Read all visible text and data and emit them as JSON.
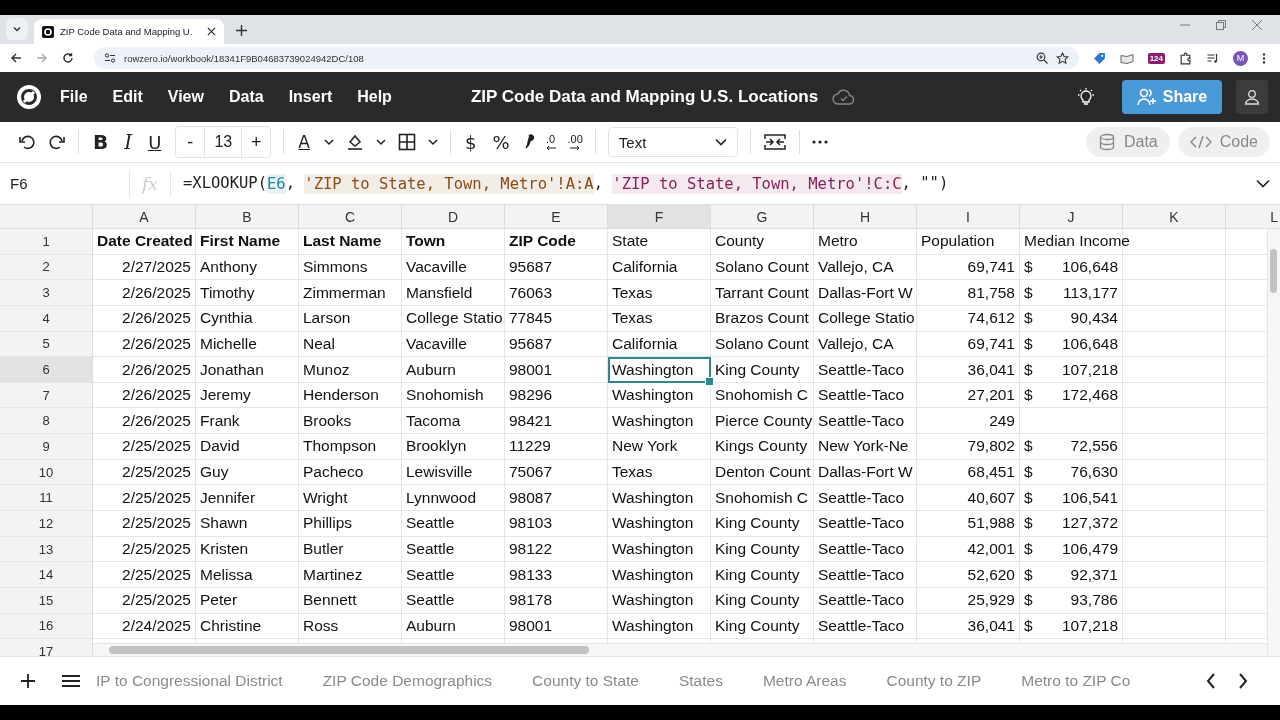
{
  "browser": {
    "tab_title": "ZIP Code Data and Mapping U.",
    "url": "rowzero.io/workbook/18341F9B04683739024942DC/108",
    "extension_badge": "124",
    "profile_initial": "M"
  },
  "app": {
    "menu": [
      "File",
      "Edit",
      "View",
      "Data",
      "Insert",
      "Help"
    ],
    "title": "ZIP Code Data and Mapping U.S. Locations",
    "share_label": "Share"
  },
  "toolbar": {
    "format_letters": [
      "B",
      "I",
      "U"
    ],
    "font_size": "13",
    "size_minus": "-",
    "size_plus": "+",
    "text_color_letter": "A",
    "currency": "$",
    "percent": "%",
    "decrease_decimals": ".0",
    "increase_decimals": ".00",
    "number_format": "Text",
    "data_label": "Data",
    "code_label": "Code"
  },
  "formula_bar": {
    "cell_name": "F6",
    "fx": "fx",
    "parts": [
      {
        "kind": "plain",
        "text": "=XLOOKUP("
      },
      {
        "kind": "ref",
        "text": "E6",
        "color": "#1f8a9c"
      },
      {
        "kind": "plain",
        "text": ", "
      },
      {
        "kind": "ref",
        "text": "'ZIP to State, Town, Metro'!A:A",
        "color": "#8a4b16"
      },
      {
        "kind": "plain",
        "text": ", "
      },
      {
        "kind": "ref",
        "text": "'ZIP to State, Town, Metro'!C:C",
        "color": "#8a1f5c"
      },
      {
        "kind": "plain",
        "text": ", \"\")"
      }
    ]
  },
  "table": {
    "columns": [
      {
        "label": "A",
        "kind": "right",
        "selected": false
      },
      {
        "label": "B",
        "kind": "left",
        "selected": false
      },
      {
        "label": "C",
        "kind": "left",
        "selected": false
      },
      {
        "label": "D",
        "kind": "left",
        "selected": false
      },
      {
        "label": "E",
        "kind": "left",
        "selected": false
      },
      {
        "label": "F",
        "kind": "left",
        "selected": true
      },
      {
        "label": "G",
        "kind": "left",
        "selected": false
      },
      {
        "label": "H",
        "kind": "left",
        "selected": false
      },
      {
        "label": "I",
        "kind": "right",
        "selected": false
      },
      {
        "label": "J",
        "kind": "currency",
        "selected": false
      },
      {
        "label": "K",
        "kind": "left",
        "selected": false
      },
      {
        "label": "L",
        "kind": "left",
        "selected": false
      }
    ],
    "rows": [
      {
        "num": "1",
        "kind": "header",
        "selected": false,
        "cells": [
          {
            "text": "Date Created",
            "bold": true
          },
          {
            "text": "First Name",
            "bold": true
          },
          {
            "text": "Last Name",
            "bold": true
          },
          {
            "text": "Town",
            "bold": true
          },
          {
            "text": "ZIP Code",
            "bold": true
          },
          {
            "text": "State",
            "bold": false
          },
          {
            "text": "County",
            "bold": false
          },
          {
            "text": "Metro",
            "bold": false
          },
          {
            "text": "Population",
            "bold": false
          },
          {
            "text": "Median Income",
            "bold": false
          }
        ]
      },
      {
        "num": "2",
        "kind": "data",
        "selected": false,
        "cells": [
          "2/27/2025",
          "Anthony",
          "Simmons",
          "Vacaville",
          "95687",
          "California",
          "Solano Count",
          "Vallejo, CA",
          "69,741",
          {
            "currency": "$",
            "amount": "106,648"
          }
        ]
      },
      {
        "num": "3",
        "kind": "data",
        "selected": false,
        "cells": [
          "2/26/2025",
          "Timothy",
          "Zimmerman",
          "Mansfield",
          "76063",
          "Texas",
          "Tarrant Count",
          "Dallas-Fort W",
          "81,758",
          {
            "currency": "$",
            "amount": "113,177"
          }
        ]
      },
      {
        "num": "4",
        "kind": "data",
        "selected": false,
        "cells": [
          "2/26/2025",
          "Cynthia",
          "Larson",
          "College Statio",
          "77845",
          "Texas",
          "Brazos Count",
          "College Statio",
          "74,612",
          {
            "currency": "$",
            "amount": "90,434"
          }
        ]
      },
      {
        "num": "5",
        "kind": "data",
        "selected": false,
        "cells": [
          "2/26/2025",
          "Michelle",
          "Neal",
          "Vacaville",
          "95687",
          "California",
          "Solano Count",
          "Vallejo, CA",
          "69,741",
          {
            "currency": "$",
            "amount": "106,648"
          }
        ]
      },
      {
        "num": "6",
        "kind": "data",
        "selected": true,
        "cells": [
          "2/26/2025",
          "Jonathan",
          "Munoz",
          "Auburn",
          "98001",
          "Washington",
          "King County",
          "Seattle-Taco",
          "36,041",
          {
            "currency": "$",
            "amount": "107,218"
          }
        ]
      },
      {
        "num": "7",
        "kind": "data",
        "selected": false,
        "cells": [
          "2/26/2025",
          "Jeremy",
          "Henderson",
          "Snohomish",
          "98296",
          "Washington",
          "Snohomish C",
          "Seattle-Taco",
          "27,201",
          {
            "currency": "$",
            "amount": "172,468"
          }
        ]
      },
      {
        "num": "8",
        "kind": "data",
        "selected": false,
        "cells": [
          "2/26/2025",
          "Frank",
          "Brooks",
          "Tacoma",
          "98421",
          "Washington",
          "Pierce County",
          "Seattle-Taco",
          "249"
        ]
      },
      {
        "num": "9",
        "kind": "data",
        "selected": false,
        "cells": [
          "2/25/2025",
          "David",
          "Thompson",
          "Brooklyn",
          "11229",
          "New York",
          "Kings County",
          "New York-Ne",
          "79,802",
          {
            "currency": "$",
            "amount": "72,556"
          }
        ]
      },
      {
        "num": "10",
        "kind": "data",
        "selected": false,
        "cells": [
          "2/25/2025",
          "Guy",
          "Pacheco",
          "Lewisville",
          "75067",
          "Texas",
          "Denton Count",
          "Dallas-Fort W",
          "68,451",
          {
            "currency": "$",
            "amount": "76,630"
          }
        ]
      },
      {
        "num": "11",
        "kind": "data",
        "selected": false,
        "cells": [
          "2/25/2025",
          "Jennifer",
          "Wright",
          "Lynnwood",
          "98087",
          "Washington",
          "Snohomish C",
          "Seattle-Taco",
          "40,607",
          {
            "currency": "$",
            "amount": "106,541"
          }
        ]
      },
      {
        "num": "12",
        "kind": "data",
        "selected": false,
        "cells": [
          "2/25/2025",
          "Shawn",
          "Phillips",
          "Seattle",
          "98103",
          "Washington",
          "King County",
          "Seattle-Taco",
          "51,988",
          {
            "currency": "$",
            "amount": "127,372"
          }
        ]
      },
      {
        "num": "13",
        "kind": "data",
        "selected": false,
        "cells": [
          "2/25/2025",
          "Kristen",
          "Butler",
          "Seattle",
          "98122",
          "Washington",
          "King County",
          "Seattle-Taco",
          "42,001",
          {
            "currency": "$",
            "amount": "106,479"
          }
        ]
      },
      {
        "num": "14",
        "kind": "data",
        "selected": false,
        "cells": [
          "2/25/2025",
          "Melissa",
          "Martinez",
          "Seattle",
          "98133",
          "Washington",
          "King County",
          "Seattle-Taco",
          "52,620",
          {
            "currency": "$",
            "amount": "92,371"
          }
        ]
      },
      {
        "num": "15",
        "kind": "data",
        "selected": false,
        "cells": [
          "2/25/2025",
          "Peter",
          "Bennett",
          "Seattle",
          "98178",
          "Washington",
          "King County",
          "Seattle-Taco",
          "25,929",
          {
            "currency": "$",
            "amount": "93,786"
          }
        ]
      },
      {
        "num": "16",
        "kind": "data",
        "selected": false,
        "cells": [
          "2/24/2025",
          "Christine",
          "Ross",
          "Auburn",
          "98001",
          "Washington",
          "King County",
          "Seattle-Taco",
          "36,041",
          {
            "currency": "$",
            "amount": "107,218"
          }
        ]
      },
      {
        "num": "17",
        "kind": "data",
        "selected": false,
        "cells": []
      }
    ]
  },
  "sheet_tabs": [
    {
      "label": "IP to Congressional District",
      "selected": false
    },
    {
      "label": "ZIP Code Demographics",
      "selected": false
    },
    {
      "label": "County to State",
      "selected": false
    },
    {
      "label": "States",
      "selected": false
    },
    {
      "label": "Metro Areas",
      "selected": false
    },
    {
      "label": "County to ZIP",
      "selected": false
    },
    {
      "label": "Metro to ZIP Co",
      "selected": false
    }
  ]
}
